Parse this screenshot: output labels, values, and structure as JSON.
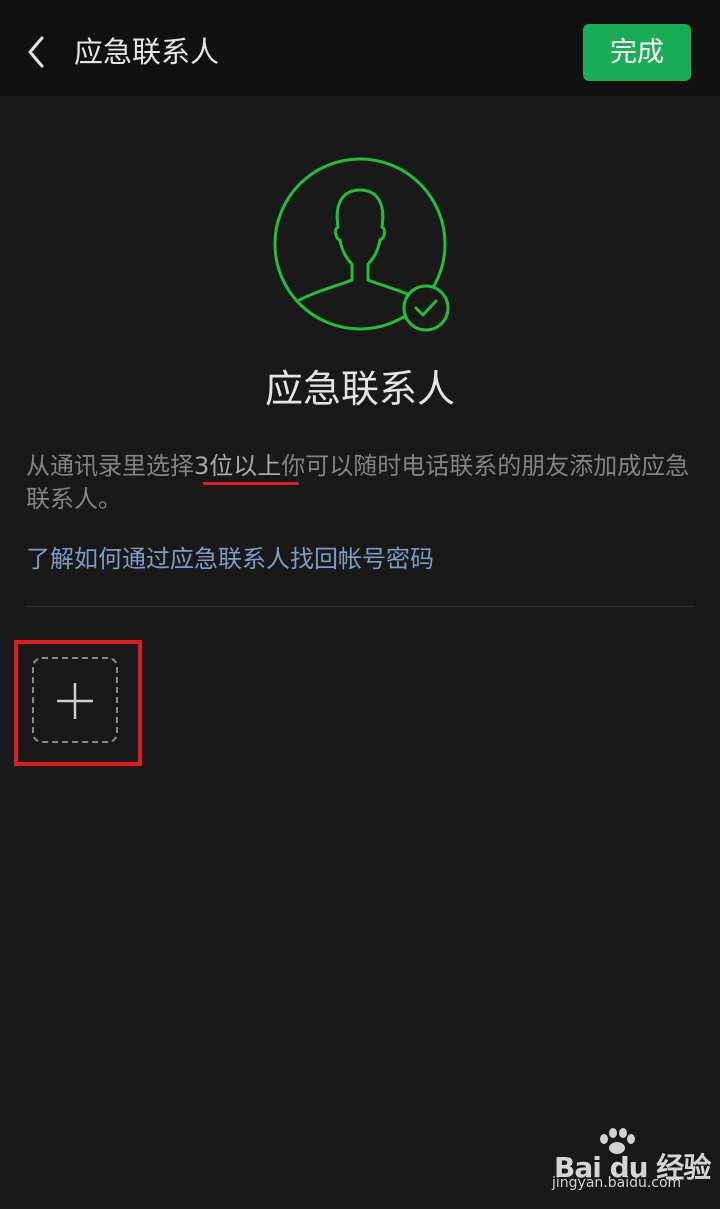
{
  "header": {
    "title": "应急联系人",
    "done_label": "完成"
  },
  "main": {
    "heading": "应急联系人",
    "description_part1": "从通讯录里选择",
    "description_highlight": "3位以上",
    "description_part2": "你可以随时电话联系的朋友添加成应急联系人。",
    "help_link": "了解如何通过应急联系人找回帐号密码"
  },
  "watermark": {
    "brand": "Bai du 经验",
    "url": "jingyan.baidu.com"
  },
  "colors": {
    "accent_green": "#1aad57",
    "avatar_green": "#20c036",
    "annotation_red": "#e01d1d",
    "link_blue": "#7f9bc4"
  },
  "icons": [
    "back-arrow-icon",
    "user-avatar-icon",
    "check-badge-icon",
    "plus-icon",
    "baidu-paw-icon"
  ]
}
